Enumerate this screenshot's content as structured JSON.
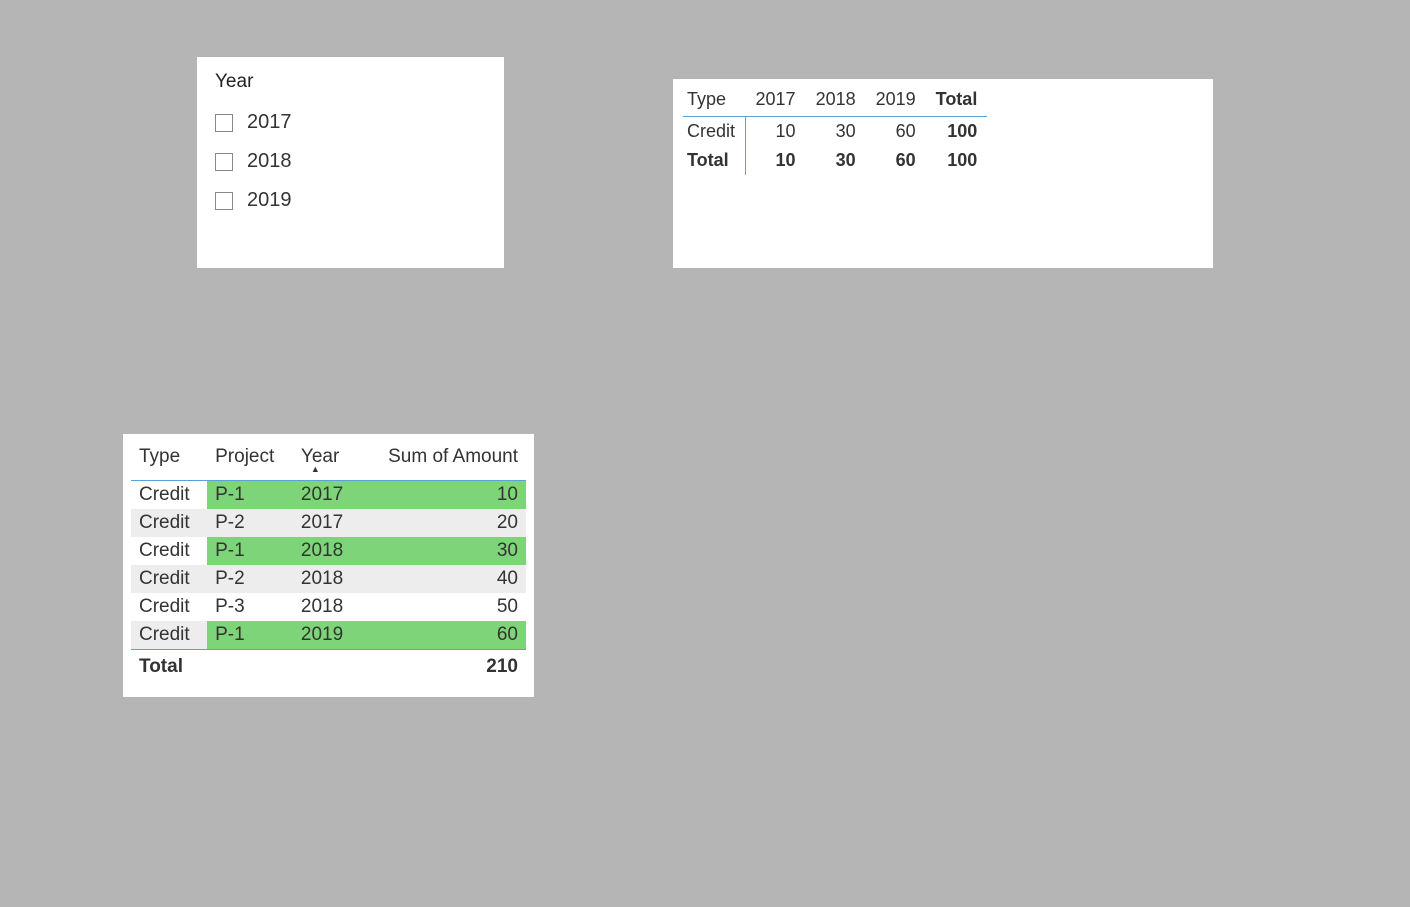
{
  "slicer": {
    "title": "Year",
    "items": [
      "2017",
      "2018",
      "2019"
    ]
  },
  "matrix": {
    "row_header": "Type",
    "col_headers": [
      "2017",
      "2018",
      "2019"
    ],
    "total_label": "Total",
    "rows": [
      {
        "label": "Credit",
        "values": [
          10,
          30,
          60
        ],
        "total": 100
      }
    ],
    "totals_row": {
      "label": "Total",
      "values": [
        10,
        30,
        60
      ],
      "total": 100
    }
  },
  "details": {
    "columns": {
      "type": "Type",
      "project": "Project",
      "year": "Year",
      "amount": "Sum of Amount"
    },
    "sort_column": "year",
    "rows": [
      {
        "type": "Credit",
        "project": "P-1",
        "year": 2017,
        "amount": 10,
        "highlighted": true,
        "stripe": false
      },
      {
        "type": "Credit",
        "project": "P-2",
        "year": 2017,
        "amount": 20,
        "highlighted": false,
        "stripe": true
      },
      {
        "type": "Credit",
        "project": "P-1",
        "year": 2018,
        "amount": 30,
        "highlighted": true,
        "stripe": false
      },
      {
        "type": "Credit",
        "project": "P-2",
        "year": 2018,
        "amount": 40,
        "highlighted": false,
        "stripe": true
      },
      {
        "type": "Credit",
        "project": "P-3",
        "year": 2018,
        "amount": 50,
        "highlighted": false,
        "stripe": false
      },
      {
        "type": "Credit",
        "project": "P-1",
        "year": 2019,
        "amount": 60,
        "highlighted": true,
        "stripe": true
      }
    ],
    "total_label": "Total",
    "total_value": 210
  }
}
